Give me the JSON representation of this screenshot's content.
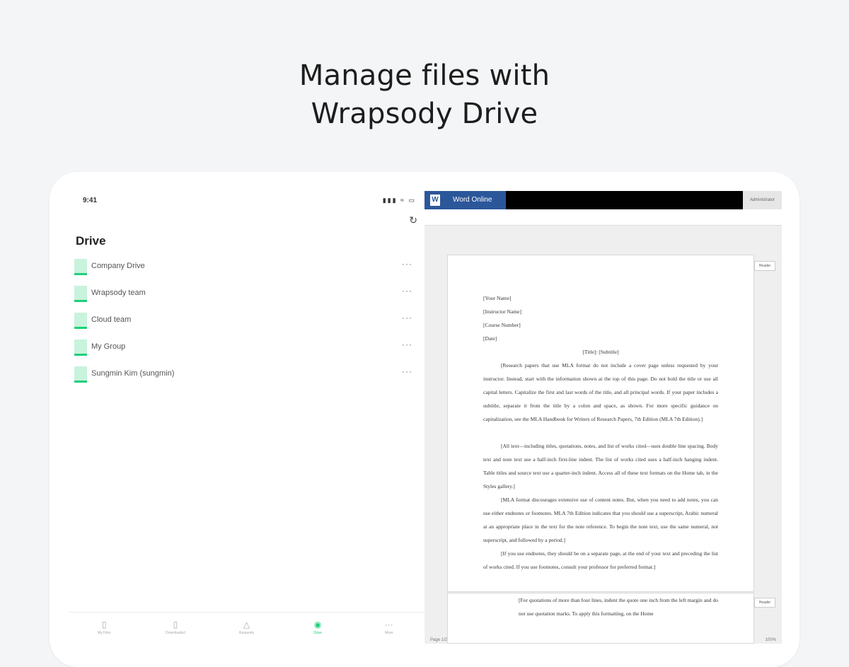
{
  "headline": {
    "line1": "Manage files with",
    "line2": "Wrapsody Drive"
  },
  "app": {
    "status_time": "9:41",
    "status_icons": "▮▮▮ ≈ ▭",
    "sync_icon": "↻",
    "title": "Drive",
    "items": [
      {
        "label": "Company Drive",
        "more": "···"
      },
      {
        "label": "Wrapsody team",
        "more": "···"
      },
      {
        "label": "Cloud team",
        "more": "···"
      },
      {
        "label": "My Group",
        "more": "···"
      },
      {
        "label": "Sungmin Kim (sungmin)",
        "more": "···"
      }
    ],
    "tabs": [
      {
        "label": "My Files",
        "icon": "▯"
      },
      {
        "label": "Downloaded",
        "icon": "▯"
      },
      {
        "label": "Requests",
        "icon": "△"
      },
      {
        "label": "Drive",
        "icon": "◉"
      },
      {
        "label": "More",
        "icon": "···"
      }
    ]
  },
  "word": {
    "logo": "W",
    "brand": "Word Online",
    "user": "Administrator",
    "header_label": "Header",
    "page_indicator": "Page 1/2",
    "zoom": "100%",
    "doc": {
      "your_name": "[Your Name]",
      "instructor": "[Instructor Name]",
      "course": "[Course Number]",
      "date": "[Date]",
      "title": "[Title]: [Subtitle]",
      "p1": "[Research papers that use MLA format do not include a cover page unless requested by your instructor. Instead, start with the information shown at the top of this page. Do not bold the title or use all capital letters. Capitalize the first and last words of the title, and all principal words. If your paper includes a subtitle, separate it from the title by a colon and space, as shown. For more specific guidance on capitalization, see the MLA Handbook for Writers of Research Papers, 7th Edition (MLA 7th Edition).]",
      "p2": "[All text—including titles, quotations, notes, and list of works cited—uses double line spacing. Body text and note text use a half-inch first-line indent. The list of works cited uses a half-inch hanging indent. Table titles and source text use a quarter-inch indent. Access all of these text formats on the Home tab, in the Styles gallery.]",
      "p3": "[MLA format discourages extensive use of content notes. But, when you need to add notes, you can use either endnotes or footnotes. MLA 7th Edition indicates that you should use a superscript, Arabic numeral at an appropriate place in the text for the note reference. To begin the note text, use the same numeral, not superscript, and followed by a period.]",
      "p4": "[If you use endnotes, they should be on a separate page, at the end of your text and preceding the list of works cited. If you use footnotes, consult your professor for preferred format.]",
      "p5": "[For quotations of more than four lines, indent the quote one inch from the left margin and do not use quotation marks. To apply this formatting, on the Home"
    }
  }
}
